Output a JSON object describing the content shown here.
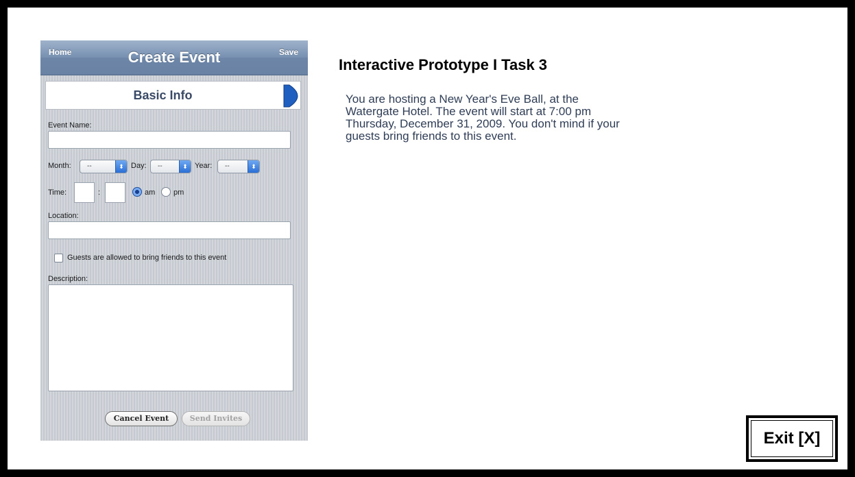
{
  "phone": {
    "navbar": {
      "home_label": "Home",
      "title": "Create Event",
      "save_label": "Save"
    },
    "section": {
      "title": "Basic Info",
      "arrow_icon": "chevron-right-icon"
    },
    "form": {
      "event_name_label": "Event Name:",
      "event_name_value": "",
      "month_label": "Month:",
      "month_value": "--",
      "day_label": "Day:",
      "day_value": "--",
      "year_label": "Year:",
      "year_value": "--",
      "time_label": "Time:",
      "time_separator": ":",
      "hour_value": "",
      "minute_value": "",
      "am_label": "am",
      "pm_label": "pm",
      "am_selected": true,
      "location_label": "Location:",
      "location_value": "",
      "guests_checkbox_label": "Guests are allowed to bring friends to this event",
      "guests_checked": false,
      "description_label": "Description:",
      "description_value": ""
    },
    "buttons": {
      "cancel_label": "Cancel Event",
      "send_label": "Send Invites"
    },
    "colors": {
      "navbar": "#7790b1",
      "accent_blue": "#2b6fd6",
      "section_text": "#3a4a66"
    }
  },
  "task": {
    "title": "Interactive Prototype I Task 3",
    "description": "You are hosting a New Year's Eve Ball, at the Watergate Hotel. The event will start at 7:00 pm Thursday, December 31, 2009. You don't mind if your guests bring friends to this event."
  },
  "exit": {
    "label": "Exit [X]"
  }
}
